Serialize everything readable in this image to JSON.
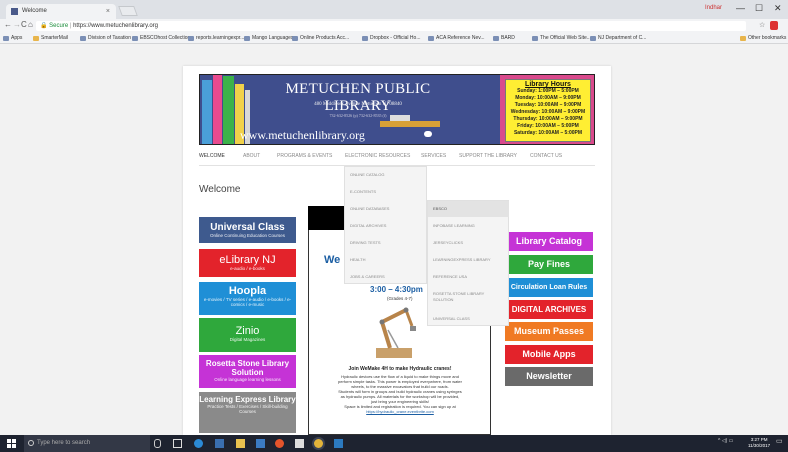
{
  "browser": {
    "tab_title": "Welcome",
    "tab_close": "×",
    "user": "Indhar",
    "win_min": "—",
    "win_max": "☐",
    "win_close": "✕",
    "nav_back": "←",
    "nav_forward": "→",
    "nav_reload": "C",
    "nav_home": "⌂",
    "secure": "Secure",
    "url": "https://www.metuchenlibrary.org",
    "star": "☆"
  },
  "bookmarks": [
    {
      "label": "Apps"
    },
    {
      "label": "SmarterMail"
    },
    {
      "label": "Division of Taxation"
    },
    {
      "label": "EBSCOhost Collection"
    },
    {
      "label": "reports.learningexpr..."
    },
    {
      "label": "Mango Languages"
    },
    {
      "label": "Online Products Acc..."
    },
    {
      "label": "Dropbox - Official Ho..."
    },
    {
      "label": "ACA Reference Nev..."
    },
    {
      "label": "BARD"
    },
    {
      "label": "The Official Web Site..."
    },
    {
      "label": "NJ Department of C..."
    },
    {
      "label": "Other bookmarks"
    }
  ],
  "banner": {
    "title": "METUCHEN PUBLIC LIBRARY",
    "address": "480 Middlesex Avenue   Metuchen NJ   08840",
    "phone": "732-632-8526 (p)   732-632-8535 (f)",
    "url": "www.metuchenlibrary.org",
    "hours_title": "Library Hours",
    "hours": [
      "Sunday: 1:00PM – 5:00PM",
      "Monday: 10:00AM – 9:00PM",
      "Tuesday: 10:00AM – 9:00PM",
      "Wednesday: 10:00AM – 9:00PM",
      "Thursday: 10:00AM – 9:00PM",
      "Friday: 10:00AM – 5:00PM",
      "Saturday: 10:00AM – 5:00PM"
    ]
  },
  "nav": [
    "WELCOME",
    "ABOUT",
    "PROGRAMS & EVENTS",
    "ELECTRONIC RESOURCES",
    "SERVICES",
    "SUPPORT THE LIBRARY",
    "CONTACT US"
  ],
  "dropdown": {
    "items": [
      "ONLINE CATALOG",
      "E-CONTENTS",
      "ONLINE DATABASES",
      "DIGITAL ARCHIVES",
      "DRIVING TESTS",
      "HEALTH",
      "JOBS & CAREERS"
    ],
    "sub_items": [
      "EBSCO",
      "INFOBASE LEARNING",
      "JERSEYCLICKS",
      "LEARNINGEXPRESS LIBRARY",
      "REFERENCE USA",
      "ROSETTA STONE LIBRARY SOLUTION",
      "UNIVERSAL CLASS"
    ]
  },
  "welcome": "Welcome",
  "left_buttons": [
    {
      "title": "Universal Class",
      "sub": "Online Continuing Education Courses",
      "color": "#3e5a8e"
    },
    {
      "title": "eLibrary NJ",
      "sub": "e-audio / e-books",
      "color": "#e3232b"
    },
    {
      "title": "Hoopla",
      "sub": "e-movies / TV series / e-audio / e-books / e-comics / e-music",
      "color": "#1f8fd6"
    },
    {
      "title": "Zinio",
      "sub": "Digital Magazines",
      "color": "#2fa83c"
    },
    {
      "title": "Rosetta Stone Library Solution",
      "sub": "Online language learning lessons",
      "color": "#c533d6"
    },
    {
      "title": "Learning Express Library",
      "sub": "Practice Tests / Exercises / Skill-building Courses",
      "color": "#8a8a8a"
    }
  ],
  "right_buttons": [
    {
      "label": "Library Catalog",
      "color": "#c533d6"
    },
    {
      "label": "Pay Fines",
      "color": "#2fa83c"
    },
    {
      "label": "Circulation Loan Rules",
      "color": "#1f8fd6"
    },
    {
      "label": "DIGITAL ARCHIVES",
      "color": "#e3232b"
    },
    {
      "label": "Museum Passes",
      "color": "#f07a23"
    },
    {
      "label": "Mobile Apps",
      "color": "#e3232b"
    },
    {
      "label": "Newsletter",
      "color": "#6a6a6a"
    }
  ],
  "flyer": {
    "we": "We",
    "time": "3:00 – 4:30pm",
    "grades": "(Grades 4-7)",
    "headline": "Join WeMake 4H to make Hydraulic cranes!",
    "body": [
      "Hydraulic devices use the flow of a liquid to make things move and",
      "perform simple tasks. This power is employed everywhere, from water",
      "wheels, to the massive excavators that build our roads.",
      "Students will form in groups and build hydraulic cranes using syringes",
      "as hydraulic pumps. All materials for the workshop will be provided,",
      "just bring your engineering skills!",
      "Space is limited and registration is required.  You can sign up at"
    ],
    "link": "https://hydraulic_crane.eventbrite.com"
  },
  "taskbar": {
    "search_placeholder": "Type here to search",
    "tray": "^  ◁)  ▭",
    "time": "3:27 PM",
    "date": "11/30/2017"
  }
}
